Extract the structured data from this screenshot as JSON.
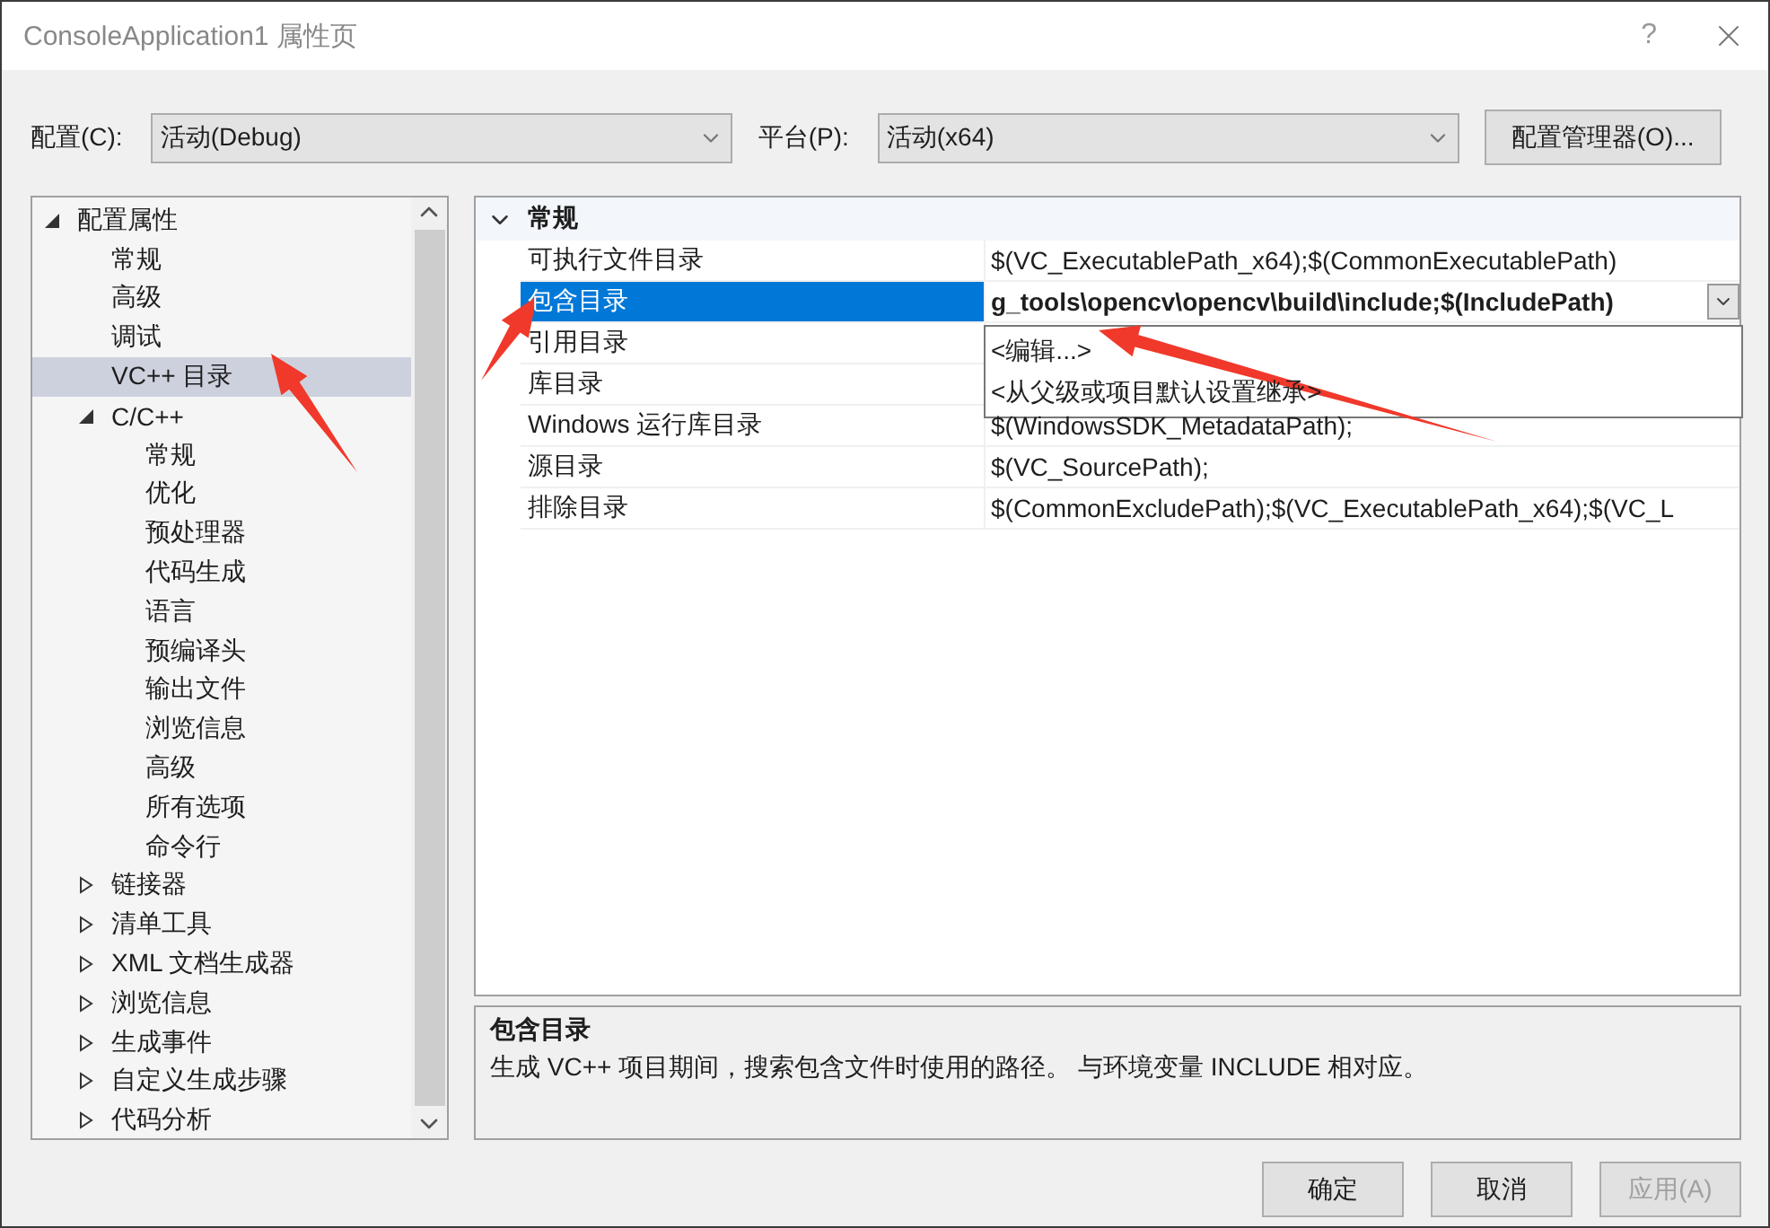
{
  "window": {
    "title": "ConsoleApplication1 属性页",
    "help": "?"
  },
  "config": {
    "label": "配置(C):",
    "value": "活动(Debug)"
  },
  "platform": {
    "label": "平台(P):",
    "value": "活动(x64)"
  },
  "manager_button": "配置管理器(O)...",
  "tree": [
    {
      "label": "配置属性",
      "kind": "group",
      "expanded": true,
      "selected": false,
      "children": [
        {
          "label": "常规",
          "kind": "leaf",
          "selected": false
        },
        {
          "label": "高级",
          "kind": "leaf",
          "selected": false
        },
        {
          "label": "调试",
          "kind": "leaf",
          "selected": false
        },
        {
          "label": "VC++ 目录",
          "kind": "leaf",
          "selected": true
        },
        {
          "label": "C/C++",
          "kind": "group",
          "expanded": true,
          "selected": false,
          "children": [
            {
              "label": "常规",
              "kind": "leaf",
              "selected": false
            },
            {
              "label": "优化",
              "kind": "leaf",
              "selected": false
            },
            {
              "label": "预处理器",
              "kind": "leaf",
              "selected": false
            },
            {
              "label": "代码生成",
              "kind": "leaf",
              "selected": false
            },
            {
              "label": "语言",
              "kind": "leaf",
              "selected": false
            },
            {
              "label": "预编译头",
              "kind": "leaf",
              "selected": false
            },
            {
              "label": "输出文件",
              "kind": "leaf",
              "selected": false
            },
            {
              "label": "浏览信息",
              "kind": "leaf",
              "selected": false
            },
            {
              "label": "高级",
              "kind": "leaf",
              "selected": false
            },
            {
              "label": "所有选项",
              "kind": "leaf",
              "selected": false
            },
            {
              "label": "命令行",
              "kind": "leaf",
              "selected": false
            }
          ]
        },
        {
          "label": "链接器",
          "kind": "group",
          "expanded": false,
          "selected": false
        },
        {
          "label": "清单工具",
          "kind": "group",
          "expanded": false,
          "selected": false
        },
        {
          "label": "XML 文档生成器",
          "kind": "group",
          "expanded": false,
          "selected": false
        },
        {
          "label": "浏览信息",
          "kind": "group",
          "expanded": false,
          "selected": false
        },
        {
          "label": "生成事件",
          "kind": "group",
          "expanded": false,
          "selected": false
        },
        {
          "label": "自定义生成步骤",
          "kind": "group",
          "expanded": false,
          "selected": false
        },
        {
          "label": "代码分析",
          "kind": "group",
          "expanded": false,
          "selected": false
        }
      ]
    }
  ],
  "properties": {
    "section": "常规",
    "expanded": true,
    "rows": [
      {
        "name": "可执行文件目录",
        "value": "$(VC_ExecutablePath_x64);$(CommonExecutablePath)",
        "selected": false
      },
      {
        "name": "包含目录",
        "value": "g_tools\\opencv\\opencv\\build\\include;$(IncludePath)",
        "selected": true
      },
      {
        "name": "引用目录",
        "value": "",
        "selected": false
      },
      {
        "name": "库目录",
        "value": "",
        "selected": false
      },
      {
        "name": "Windows 运行库目录",
        "value": "$(WindowsSDK_MetadataPath);",
        "selected": false
      },
      {
        "name": "源目录",
        "value": "$(VC_SourcePath);",
        "selected": false
      },
      {
        "name": "排除目录",
        "value": "$(CommonExcludePath);$(VC_ExecutablePath_x64);$(VC_L",
        "selected": false
      }
    ]
  },
  "dropdown_options": [
    "<编辑...>",
    "<从父级或项目默认设置继承>"
  ],
  "description": {
    "title": "包含目录",
    "text": "生成 VC++ 项目期间，搜索包含文件时使用的路径。 与环境变量 INCLUDE 相对应。"
  },
  "buttons": [
    {
      "label": "确定",
      "disabled": false
    },
    {
      "label": "取消",
      "disabled": false
    },
    {
      "label": "应用(A)",
      "disabled": true
    }
  ]
}
